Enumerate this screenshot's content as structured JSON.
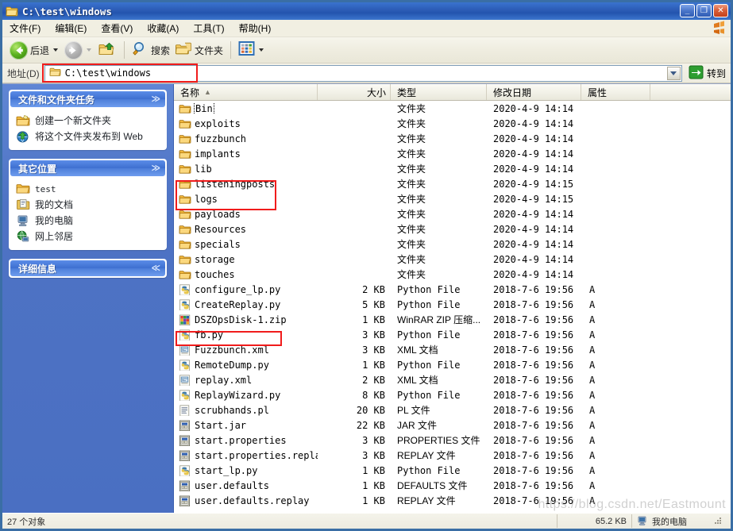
{
  "window": {
    "title": "C:\\test\\windows",
    "icon": "folder-icon",
    "buttons": {
      "minimize": "_",
      "maximize": "❐",
      "close": "✕"
    }
  },
  "menu": {
    "items": [
      {
        "name": "file",
        "label": "文件(F)"
      },
      {
        "name": "edit",
        "label": "编辑(E)"
      },
      {
        "name": "view",
        "label": "查看(V)"
      },
      {
        "name": "favorites",
        "label": "收藏(A)"
      },
      {
        "name": "tools",
        "label": "工具(T)"
      },
      {
        "name": "help",
        "label": "帮助(H)"
      }
    ]
  },
  "toolbar": {
    "back": "后退",
    "forward": "",
    "up": "",
    "search": "搜索",
    "folders": "文件夹",
    "views": ""
  },
  "address": {
    "label": "地址(D)",
    "value": "C:\\test\\windows",
    "go_label": "转到"
  },
  "sidebar": {
    "panels": [
      {
        "title": "文件和文件夹任务",
        "chevron": "≫",
        "items": [
          {
            "label": "创建一个新文件夹",
            "icon": "new-folder-icon"
          },
          {
            "label": "将这个文件夹发布到 Web",
            "icon": "publish-web-icon"
          }
        ]
      },
      {
        "title": "其它位置",
        "chevron": "≫",
        "items": [
          {
            "label": "test",
            "icon": "folder-icon",
            "mono": true
          },
          {
            "label": "我的文档",
            "icon": "my-documents-icon"
          },
          {
            "label": "我的电脑",
            "icon": "my-computer-icon"
          },
          {
            "label": "网上邻居",
            "icon": "network-places-icon"
          }
        ]
      },
      {
        "title": "详细信息",
        "chevron": "≪",
        "items": []
      }
    ]
  },
  "file_list": {
    "columns": [
      {
        "key": "name",
        "label": "名称",
        "sorted": true,
        "sort_arrow": "▲"
      },
      {
        "key": "size",
        "label": "大小"
      },
      {
        "key": "type",
        "label": "类型"
      },
      {
        "key": "date",
        "label": "修改日期"
      },
      {
        "key": "attr",
        "label": "属性"
      }
    ],
    "rows": [
      {
        "name": "Bin",
        "icon": "folder-icon",
        "size": "",
        "type": "文件夹",
        "date": "2020-4-9 14:14",
        "attr": "",
        "focused": true
      },
      {
        "name": "exploits",
        "icon": "folder-icon",
        "size": "",
        "type": "文件夹",
        "date": "2020-4-9 14:14",
        "attr": ""
      },
      {
        "name": "fuzzbunch",
        "icon": "folder-icon",
        "size": "",
        "type": "文件夹",
        "date": "2020-4-9 14:14",
        "attr": ""
      },
      {
        "name": "implants",
        "icon": "folder-icon",
        "size": "",
        "type": "文件夹",
        "date": "2020-4-9 14:14",
        "attr": ""
      },
      {
        "name": "lib",
        "icon": "folder-icon",
        "size": "",
        "type": "文件夹",
        "date": "2020-4-9 14:14",
        "attr": ""
      },
      {
        "name": "listeningposts",
        "icon": "folder-icon",
        "size": "",
        "type": "文件夹",
        "date": "2020-4-9 14:15",
        "attr": ""
      },
      {
        "name": "logs",
        "icon": "folder-icon",
        "size": "",
        "type": "文件夹",
        "date": "2020-4-9 14:15",
        "attr": ""
      },
      {
        "name": "payloads",
        "icon": "folder-icon",
        "size": "",
        "type": "文件夹",
        "date": "2020-4-9 14:14",
        "attr": ""
      },
      {
        "name": "Resources",
        "icon": "folder-icon",
        "size": "",
        "type": "文件夹",
        "date": "2020-4-9 14:14",
        "attr": ""
      },
      {
        "name": "specials",
        "icon": "folder-icon",
        "size": "",
        "type": "文件夹",
        "date": "2020-4-9 14:14",
        "attr": ""
      },
      {
        "name": "storage",
        "icon": "folder-icon",
        "size": "",
        "type": "文件夹",
        "date": "2020-4-9 14:14",
        "attr": ""
      },
      {
        "name": "touches",
        "icon": "folder-icon",
        "size": "",
        "type": "文件夹",
        "date": "2020-4-9 14:14",
        "attr": ""
      },
      {
        "name": "configure_lp.py",
        "icon": "python-icon",
        "size": "2 KB",
        "type": "Python File",
        "date": "2018-7-6 19:56",
        "attr": "A"
      },
      {
        "name": "CreateReplay.py",
        "icon": "python-icon",
        "size": "5 KB",
        "type": "Python File",
        "date": "2018-7-6 19:56",
        "attr": "A"
      },
      {
        "name": "DSZOpsDisk-1.zip",
        "icon": "winrar-icon",
        "size": "1 KB",
        "type": "WinRAR ZIP 压缩...",
        "date": "2018-7-6 19:56",
        "attr": "A"
      },
      {
        "name": "fb.py",
        "icon": "python-icon",
        "size": "3 KB",
        "type": "Python File",
        "date": "2018-7-6 19:56",
        "attr": "A"
      },
      {
        "name": "Fuzzbunch.xml",
        "icon": "xml-icon",
        "size": "3 KB",
        "type": "XML 文档",
        "date": "2018-7-6 19:56",
        "attr": "A"
      },
      {
        "name": "RemoteDump.py",
        "icon": "python-icon",
        "size": "1 KB",
        "type": "Python File",
        "date": "2018-7-6 19:56",
        "attr": "A"
      },
      {
        "name": "replay.xml",
        "icon": "xml-icon",
        "size": "2 KB",
        "type": "XML 文档",
        "date": "2018-7-6 19:56",
        "attr": "A"
      },
      {
        "name": "ReplayWizard.py",
        "icon": "python-icon",
        "size": "8 KB",
        "type": "Python File",
        "date": "2018-7-6 19:56",
        "attr": "A"
      },
      {
        "name": "scrubhands.pl",
        "icon": "perl-icon",
        "size": "20 KB",
        "type": "PL 文件",
        "date": "2018-7-6 19:56",
        "attr": "A"
      },
      {
        "name": "Start.jar",
        "icon": "jar-icon",
        "size": "22 KB",
        "type": "JAR 文件",
        "date": "2018-7-6 19:56",
        "attr": "A"
      },
      {
        "name": "start.properties",
        "icon": "jar-icon",
        "size": "3 KB",
        "type": "PROPERTIES 文件",
        "date": "2018-7-6 19:56",
        "attr": "A"
      },
      {
        "name": "start.properties.replay",
        "icon": "jar-icon",
        "size": "3 KB",
        "type": "REPLAY 文件",
        "date": "2018-7-6 19:56",
        "attr": "A"
      },
      {
        "name": "start_lp.py",
        "icon": "python-icon",
        "size": "1 KB",
        "type": "Python File",
        "date": "2018-7-6 19:56",
        "attr": "A"
      },
      {
        "name": "user.defaults",
        "icon": "jar-icon",
        "size": "1 KB",
        "type": "DEFAULTS 文件",
        "date": "2018-7-6 19:56",
        "attr": "A"
      },
      {
        "name": "user.defaults.replay",
        "icon": "jar-icon",
        "size": "1 KB",
        "type": "REPLAY 文件",
        "date": "2018-7-6 19:56",
        "attr": "A"
      }
    ]
  },
  "annotations": {
    "color": "#F01C1C",
    "boxes": [
      {
        "name": "address-highlight",
        "target": "C:\\test\\windows"
      },
      {
        "name": "folders-highlight",
        "target": "listeningposts / logs"
      },
      {
        "name": "fuzzbunch-xml-highlight",
        "target": "Fuzzbunch.xml"
      }
    ]
  },
  "statusbar": {
    "count": "27 个对象",
    "size": "65.2 KB",
    "location": "我的电脑"
  },
  "watermark": "https://blog.csdn.net/Eastmount"
}
